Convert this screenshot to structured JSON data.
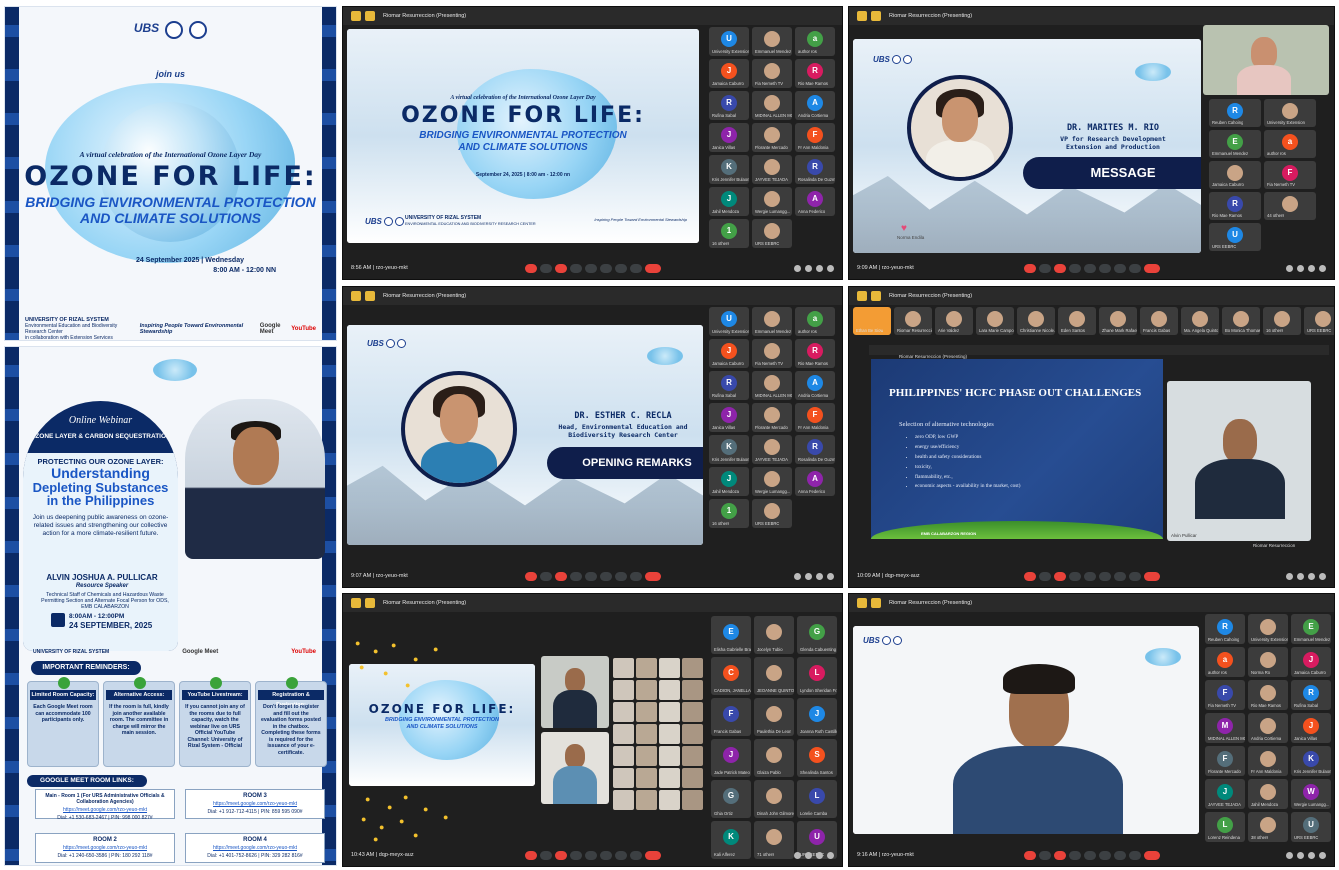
{
  "poster1": {
    "logo": "UBS",
    "join_us": "join us",
    "virtual_line": "A virtual celebration of the International Ozone Layer Day",
    "ozone_title": "OZONE FOR LIFE:",
    "bridge_line1": "BRIDGING ENVIRONMENTAL PROTECTION",
    "bridge_line2": "AND CLIMATE SOLUTIONS",
    "date_line": "24 September 2025 | Wednesday",
    "time_line": "8:00 AM - 12:00 NN",
    "org_name": "UNIVERSITY OF RIZAL SYSTEM",
    "org_sub": "Environmental Education and Biodiversity Research Center",
    "org_sub2": "in collaboration with Extension Services",
    "tagline": "Inspiring People Toward Environmental Stewardship",
    "google_meet": "Google Meet",
    "youtube": "YouTube"
  },
  "poster2": {
    "online_webinar": "Online Webinar",
    "topic": "OZONE LAYER & CARBON SEQUESTRATION",
    "protecting": "PROTECTING OUR OZONE LAYER:",
    "understanding": "Understanding",
    "depleting": "Depleting Substances",
    "in_ph": "in the Philippines",
    "blurb": "Join us deepening public awareness on ozone-related issues and strengthening our collective action for a more climate-resilient future.",
    "speaker": "ALVIN JOSHUA A. PULLICAR",
    "role": "Resource Speaker",
    "speaker_desc": "Technical Staff of Chemicals and Hazardous Waste Permitting Section and Alternate Focal Person for ODS, EMB CALABARZON",
    "time": "8:00AM - 12:00PM",
    "date": "24 SEPTEMBER, 2025",
    "org_name": "UNIVERSITY OF RIZAL SYSTEM",
    "google_meet": "Google Meet",
    "youtube": "YouTube",
    "reminders_title": "IMPORTANT REMINDERS:",
    "reminders": [
      {
        "head": "Limited Room Capacity:",
        "body": "Each Google Meet room can accommodate 100 participants only."
      },
      {
        "head": "Alternative Access:",
        "body": "If the room is full, kindly join another available room. The committee in charge will mirror the main session."
      },
      {
        "head": "YouTube Livestream:",
        "body": "If you cannot join any of the rooms due to full capacity, watch the webinar live on URS Official YouTube Channel: University of Rizal System - Official"
      },
      {
        "head": "Registration & Evaluation:",
        "body": "Don't forget to register and fill out the evaluation forms posted in the chatbox. Completing these forms is required for the issuance of your e-certificate."
      }
    ],
    "links_title": "GOOGLE MEET ROOM LINKS:",
    "rooms": [
      {
        "title": "Main - Room 1 (For URS Administrative Officials & Collaboration Agencies)",
        "link": "https://meet.google.com/rzo-yeuo-mkt",
        "dial": "Dial: +1 530-683-2467 | PIN: 998 000 827#"
      },
      {
        "title": "ROOM 3",
        "link": "https://meet.google.com/rzo-yeuo-mkt",
        "dial": "Dial: +1 912-712-4115 | PIN: 859 595 090#"
      },
      {
        "title": "ROOM 2",
        "link": "https://meet.google.com/rzo-yeuo-mkt",
        "dial": "Dial: +1 240-650-3586 | PIN: 180 292 118#"
      },
      {
        "title": "ROOM 4",
        "link": "https://meet.google.com/rzo-yeuo-mkt",
        "dial": "Dial: +1 401-752-8626 | PIN: 329 282 816#"
      }
    ]
  },
  "meet_common": {
    "presenting": "Riomar Resurreccion (Presenting)",
    "meeting_code": "rzo-yeuo-mkt",
    "meeting_code2": "dqp-meyx-auz"
  },
  "m1": {
    "time": "8:56 AM",
    "virtual_line": "A virtual celebration of the International Ozone Layer Day",
    "ozone_title": "OZONE FOR LIFE:",
    "bridge1": "BRIDGING ENVIRONMENTAL PROTECTION",
    "bridge2": "AND CLIMATE SOLUTIONS",
    "date": "September 24, 2025 | 8:00 am - 12:00 nn",
    "org": "UNIVERSITY OF RIZAL SYSTEM",
    "org_sub": "ENVIRONMENTAL EDUCATION AND BIODIVERSITY RESEARCH CENTER",
    "tagline": "Inspiring People Toward Environmental Stewardship",
    "participants": [
      "University Extension",
      "Emmanuel Mendez",
      "author ros",
      "Jamaica Caburro",
      "Fia Nemeth TV",
      "Rio Mae Ramos",
      "Rufina Sabal",
      "MIDINAL ALLEN MO...",
      "Andria Cortiema",
      "Janica Villas",
      "Florante Mercado",
      "Fr Ann Maldonia",
      "Kris Jennifer Bulaong",
      "JAYVEE TEJADA",
      "Rosalinda De Guzman",
      "Jahil Mendoza",
      "Wergie Lumangg...",
      "Anna Federico",
      "16 others",
      "URS EEBRC"
    ]
  },
  "m2": {
    "time": "9:09 AM",
    "name": "DR. MARITES M. RIO",
    "title1": "VP for Research Development",
    "title2": "Extension and Production",
    "label": "MESSAGE",
    "presenter_tag": "Norma Endila",
    "participants": [
      "Reuben Cahoing",
      "University Extension",
      "Emmanuel Mendez",
      "author ros",
      "Jamaica Caburro",
      "Fia Nemeth TV",
      "Rio Mae Ramos",
      "44 others",
      "URS EEBRC"
    ]
  },
  "m3": {
    "time": "9:07 AM",
    "name": "DR. ESTHER C. RECLA",
    "title1": "Head, Environmental Education and",
    "title2": "Biodiversity Research Center",
    "label": "OPENING REMARKS",
    "participants": [
      "University Extension",
      "Emmanuel Mendez",
      "author ros",
      "Jamaica Caburro",
      "Fia Nemeth TV",
      "Rio Mae Ramos",
      "Rufina Sabal",
      "MIDINAL ALLEN MO...",
      "Andria Cortiema",
      "Janica Villas",
      "Florante Mercado",
      "Fr Ann Maldonia",
      "Kris Jennifer Bulaong",
      "JAYVEE TEJADA",
      "Rosalinda De Guzman",
      "Jahil Mendoza",
      "Wergie Lumangg...",
      "Anna Federico",
      "16 others",
      "URS EEBRC"
    ]
  },
  "m4": {
    "time": "10:09 AM",
    "top_participants": [
      "Ethan Be Siow",
      "Riomar Resurreccion",
      "Arie Valdez",
      "Lara Marie Campo",
      "Christianne Nicole...",
      "Eden Santos",
      "Zhane Mark Rafael",
      "Francis Gabas",
      "Ma. Angela Quinto",
      "Bo Monica Thomas",
      "16 others",
      "URS EEBRC"
    ],
    "inner_presenting": "Riomar Resurreccion (Presenting)",
    "slide_title": "PHILIPPINES' HCFC PHASE OUT CHALLENGES",
    "slide_lead": "Selection of alternative technologies",
    "slide_bullets": [
      "zero ODP, low GWP",
      "energy use/efficiency",
      "health and safety considerations",
      "toxicity,",
      "flammability, etc.,",
      "economic aspects - availability in the market, cost)"
    ],
    "slide_footer": "EMB CALABARZON REGION",
    "speaker_label": "Alvin Pullicar",
    "self_label": "Riomar Resurreccion"
  },
  "m5": {
    "time": "10:43 AM",
    "participants": [
      "Elisha Gabrielle Bra...",
      "Jocelyn Tubio",
      "Glenda Cabuenting",
      "CADION, JANELLA A...",
      "JEOANNE QUINTO",
      "Lyndon Sheridan Fr...",
      "Francis Gabas",
      "Paulethia De Leon",
      "Joanna Ruth Castillo",
      "Jade Patrick Mateo",
      "Glaiza Pablo",
      "Shealinda Santos",
      "Ghia Ortiz",
      "Dinah John Gilmore S.",
      "Lorelie Camba",
      "Kali Alferez",
      "71 others",
      "URS EEBRC"
    ]
  },
  "m6": {
    "time": "9:16 AM",
    "participants": [
      "Reuben Cahoing",
      "University Extension",
      "Emmanuel Mendez",
      "author ros",
      "Norma Ro",
      "Jamaica Caburro",
      "Fia Nemeth TV",
      "Rio Mae Ramos",
      "Rufina Sabal",
      "MIDINAL ALLEN MO...",
      "Andria Cortiema",
      "Janica Villas",
      "Florante Mercado",
      "Fr Ann Maldonia",
      "Kris Jennifer Bulaong",
      "JAYVEE TEJADA",
      "Jahil Mendoza",
      "Wergie Lumangg...",
      "Lorenz Reindena",
      "38 others",
      "URS EEBRC"
    ]
  },
  "colors": {
    "navy": "#0f1e4b",
    "meet_bg": "#1f1f1f",
    "end_call": "#e9423a",
    "brand_blue": "#1d3f8f"
  }
}
